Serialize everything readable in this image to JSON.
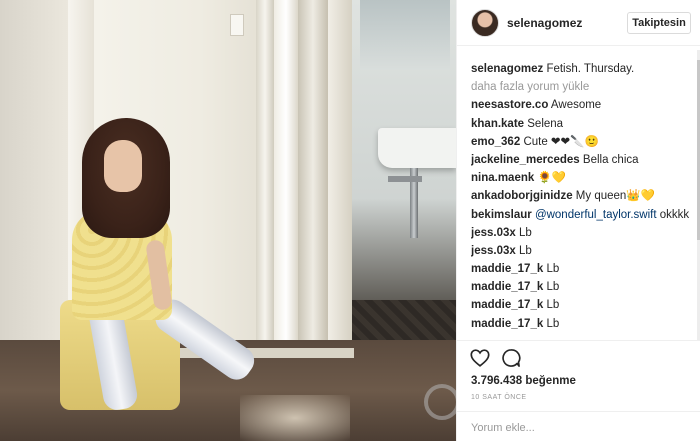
{
  "post": {
    "username": "selenagomez",
    "follow_label": "Takiptesin"
  },
  "caption": {
    "username": "selenagomez",
    "text": "Fetish. Thursday."
  },
  "load_more": "daha fazla yorum yükle",
  "comments": [
    {
      "user": "neesastore.co",
      "text": "Awesome"
    },
    {
      "user": "khan.kate",
      "text": "Selena"
    },
    {
      "user": "emo_362",
      "text": "Cute ❤❤🔪🙂"
    },
    {
      "user": "jackeline_mercedes",
      "text": "Bella chica"
    },
    {
      "user": "nina.maenk",
      "text": "🌻💛"
    },
    {
      "user": "ankadoborjginidze",
      "text": "My queen👑💛"
    },
    {
      "user": "bekimslaur",
      "mention": "@wonderful_taylor.swift",
      "text": "okkkk"
    },
    {
      "user": "jess.03x",
      "text": "Lb"
    },
    {
      "user": "jess.03x",
      "text": "Lb"
    },
    {
      "user": "maddie_17_k",
      "text": "Lb"
    },
    {
      "user": "maddie_17_k",
      "text": "Lb"
    },
    {
      "user": "maddie_17_k",
      "text": "Lb"
    },
    {
      "user": "maddie_17_k",
      "text": "Lb"
    }
  ],
  "likes": "3.796.438 beğenme",
  "time_ago": "10 SAAT ÖNCE",
  "comment_placeholder": "Yorum ekle...",
  "icons": {
    "like": "heart-icon",
    "comment": "speech-bubble-icon"
  }
}
